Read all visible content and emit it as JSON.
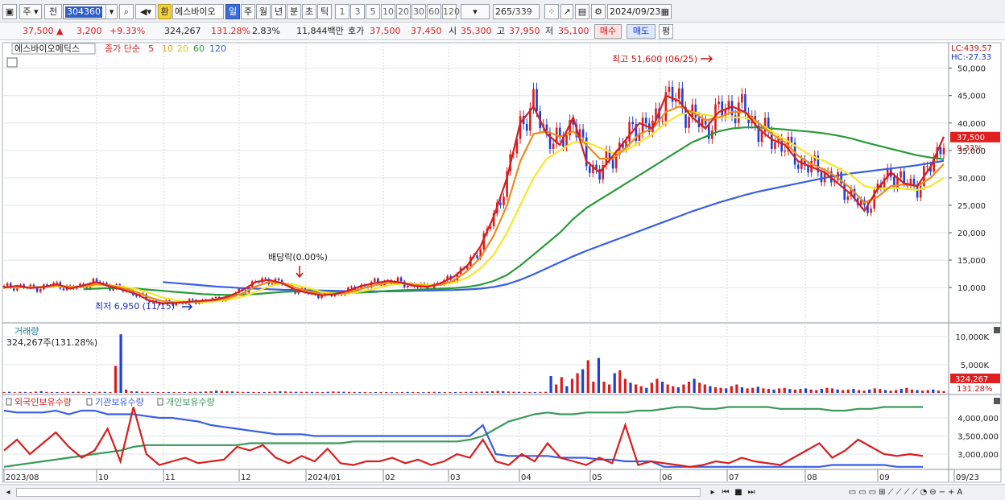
{
  "toolbar": {
    "mode": "주",
    "prev": "전",
    "code": "304360",
    "currency": "환",
    "stock_name": "에스바이오",
    "periods": [
      "일",
      "주",
      "월",
      "년",
      "분",
      "초",
      "틱"
    ],
    "intervals": [
      "1",
      "3",
      "5",
      "10",
      "20",
      "30",
      "60",
      "120"
    ],
    "count": "265",
    "total": "/339",
    "date": "2024/09/23"
  },
  "quote": {
    "price": "37,500",
    "change": "3,200",
    "change_pct": "+9.33%",
    "volume": "324,267",
    "vol_ratio": "131.28%",
    "turnover": "2.83%",
    "amount": "11,844백만",
    "bid_label": "호가",
    "bid": "37,500",
    "ask": "37,450",
    "open_label": "시",
    "open": "35,300",
    "high_label": "고",
    "high": "37,950",
    "low_label": "저",
    "low": "35,100",
    "buy_label": "매수",
    "sell_label": "매도",
    "eval_label": "평"
  },
  "colors": {
    "up": "#d81e1e",
    "down": "#1e3fd8",
    "ma5": "#d81e1e",
    "ma10": "#f08a1c",
    "ma20": "#f5e82a",
    "ma60": "#2a9a3a",
    "ma120": "#3a5fe0",
    "foreign": "#d81e1e",
    "institution": "#3a5fe0",
    "individual": "#3a9a5a"
  },
  "chart_data": [
    {
      "type": "line",
      "title": "에스바이오메딕스",
      "legend": {
        "prefix": "종가 단순",
        "items": [
          {
            "label": "5",
            "color": "#d81e1e"
          },
          {
            "label": "10",
            "color": "#f08a1c"
          },
          {
            "label": "20",
            "color": "#e8c51a"
          },
          {
            "label": "60",
            "color": "#2a9a3a"
          },
          {
            "label": "120",
            "color": "#3a5fe0"
          }
        ]
      },
      "x_labels": [
        "2023/08",
        "10",
        "11",
        "12",
        "2024/01",
        "02",
        "03",
        "04",
        "05",
        "06",
        "07",
        "08",
        "09",
        "09/23"
      ],
      "ylim": [
        4000,
        52000
      ],
      "yticks": [
        10000,
        15000,
        20000,
        25000,
        30000,
        35000,
        40000,
        45000,
        50000
      ],
      "ytick_labels": [
        "10,000",
        "15,000",
        "20,000",
        "25,000",
        "30,000",
        "35,000",
        "40,000",
        "45,000",
        "50,000"
      ],
      "annotations": {
        "high": "최고 51,600 (06/25)",
        "low": "최저 6,950 (11/15)",
        "dividend": "배당락(0.00%)",
        "lc": "LC:439.57",
        "hc": "HC:-27.33",
        "last_price": "37,500",
        "last_pct": "9.33%"
      },
      "series": [
        {
          "name": "5",
          "values": [
            10000,
            10300,
            9900,
            10100,
            10600,
            9800,
            10400,
            11000,
            10200,
            9600,
            8800,
            7600,
            7100,
            7200,
            7400,
            7600,
            7800,
            8400,
            9500,
            11000,
            11400,
            10800,
            9600,
            9000,
            8600,
            8800,
            9400,
            10300,
            10800,
            11200,
            10900,
            10300,
            10100,
            10800,
            12000,
            14000,
            17500,
            23000,
            30000,
            40000,
            43000,
            38000,
            36000,
            41000,
            33000,
            31000,
            34000,
            37000,
            40000,
            39000,
            45000,
            44000,
            41000,
            39000,
            42000,
            43000,
            42000,
            39000,
            37000,
            36000,
            33000,
            32000,
            31000,
            29000,
            27000,
            24000,
            28000,
            31000,
            29000,
            28500,
            32000,
            37500
          ]
        },
        {
          "name": "10",
          "values": [
            10000,
            10100,
            10000,
            10100,
            10400,
            10100,
            10200,
            10600,
            10400,
            9900,
            9200,
            8200,
            7500,
            7300,
            7350,
            7500,
            7700,
            8100,
            8900,
            10200,
            11000,
            10900,
            10000,
            9300,
            8800,
            8800,
            9100,
            9800,
            10400,
            10900,
            10900,
            10500,
            10300,
            10500,
            11300,
            13000,
            15500,
            19500,
            25000,
            33000,
            38000,
            38500,
            37500,
            38500,
            36000,
            33500,
            33500,
            35500,
            38000,
            39000,
            42000,
            43000,
            42000,
            40500,
            41000,
            42000,
            42000,
            40000,
            38000,
            36500,
            34000,
            32500,
            31500,
            30000,
            28000,
            25500,
            26500,
            28500,
            28800,
            28500,
            30000,
            32500
          ]
        },
        {
          "name": "20",
          "values": [
            10000,
            10000,
            10050,
            10100,
            10200,
            10150,
            10150,
            10400,
            10400,
            10200,
            9700,
            9000,
            8200,
            7700,
            7400,
            7350,
            7500,
            7800,
            8300,
            9200,
            10200,
            10800,
            10500,
            9900,
            9200,
            8900,
            8900,
            9300,
            9800,
            10400,
            10700,
            10700,
            10500,
            10500,
            10900,
            11800,
            13500,
            16000,
            20000,
            25000,
            30000,
            33500,
            35000,
            36500,
            36500,
            35500,
            34500,
            35000,
            36500,
            38000,
            40000,
            41500,
            42000,
            41500,
            41000,
            41000,
            41000,
            40000,
            38500,
            37000,
            35500,
            34000,
            33000,
            31800,
            30500,
            28500,
            28000,
            28200,
            28000,
            27800,
            28500,
            30000
          ]
        },
        {
          "name": "60",
          "values": [
            null,
            null,
            null,
            null,
            null,
            null,
            9700,
            9800,
            9900,
            9900,
            9800,
            9600,
            9400,
            9200,
            9000,
            8800,
            8700,
            8650,
            8700,
            8800,
            9000,
            9200,
            9300,
            9300,
            9200,
            9100,
            9050,
            9100,
            9200,
            9400,
            9500,
            9600,
            9700,
            9800,
            9900,
            10100,
            10500,
            11200,
            12300,
            14000,
            16000,
            18000,
            20000,
            22500,
            24500,
            26000,
            27500,
            29000,
            30500,
            32000,
            33500,
            35000,
            36500,
            37500,
            38500,
            39000,
            39200,
            39200,
            39000,
            38800,
            38600,
            38400,
            38100,
            37700,
            37200,
            36500,
            35900,
            35300,
            34700,
            34100,
            33700,
            33400
          ]
        },
        {
          "name": "120",
          "values": [
            null,
            null,
            null,
            null,
            null,
            null,
            null,
            null,
            null,
            null,
            null,
            null,
            11000,
            10800,
            10600,
            10400,
            10200,
            10050,
            9900,
            9800,
            9700,
            9600,
            9550,
            9500,
            9450,
            9400,
            9350,
            9300,
            9300,
            9300,
            9350,
            9400,
            9450,
            9500,
            9550,
            9650,
            9800,
            10100,
            10600,
            11400,
            12400,
            13500,
            14600,
            15700,
            16700,
            17600,
            18500,
            19400,
            20300,
            21200,
            22100,
            23000,
            23900,
            24700,
            25500,
            26200,
            26900,
            27500,
            28000,
            28500,
            29000,
            29500,
            30000,
            30400,
            30800,
            31100,
            31400,
            31700,
            32000,
            32300,
            32700,
            33100
          ]
        }
      ]
    },
    {
      "type": "bar",
      "title": "거래량",
      "subtitle": "324,267주(131.28%)",
      "ylim": [
        0,
        12000
      ],
      "yticks": [
        5000,
        10000
      ],
      "ytick_labels": [
        "5,000K",
        "10,000K"
      ],
      "last_value": "324,267",
      "last_pct": "131.28%",
      "values": [
        150,
        200,
        120,
        180,
        160,
        140,
        220,
        300,
        180,
        160,
        150,
        140,
        170,
        180,
        200,
        160,
        150,
        170,
        190,
        180,
        150,
        4800,
        10400,
        600,
        300,
        250,
        200,
        180,
        160,
        150,
        140,
        160,
        150,
        140,
        150,
        160,
        180,
        200,
        250,
        300,
        400,
        350,
        300,
        250,
        200,
        180,
        170,
        160,
        150,
        140,
        180,
        250,
        300,
        260,
        220,
        200,
        190,
        180,
        170,
        160,
        150,
        200,
        250,
        220,
        200,
        180,
        160,
        150,
        140,
        130,
        150,
        160,
        140,
        130,
        120,
        150,
        160,
        150,
        140,
        130,
        170,
        180,
        160,
        150,
        140,
        150,
        160,
        170,
        180,
        200,
        220,
        250,
        300,
        350,
        300,
        250,
        200,
        180,
        170,
        160,
        150,
        180,
        200,
        3000,
        1500,
        2800,
        1200,
        2500,
        3500,
        4200,
        5800,
        2000,
        6200,
        2000,
        1500,
        3500,
        4000,
        2500,
        1800,
        1500,
        1200,
        900,
        1800,
        2500,
        2000,
        1500,
        1200,
        1000,
        1500,
        2000,
        2500,
        1800,
        1500,
        1200,
        1000,
        900,
        800,
        1200,
        1500,
        1000,
        800,
        900,
        1100,
        800,
        700,
        600,
        800,
        900,
        700,
        600,
        700,
        800,
        600,
        500,
        700,
        900,
        800,
        600,
        500,
        600,
        700,
        500,
        400,
        600,
        800,
        700,
        500,
        400,
        500,
        700,
        900,
        600,
        500,
        400,
        500,
        600,
        400,
        324
      ]
    },
    {
      "type": "line",
      "title": "외국인보유수량",
      "series": [
        {
          "name": "외국인보유수량",
          "values": [
            3100000,
            3400000,
            3000000,
            3300000,
            3600000,
            3200000,
            2900000,
            3100000,
            3700000,
            2800000,
            4300000,
            3000000,
            2700000,
            2800000,
            2900000,
            2750000,
            2800000,
            2850000,
            3200000,
            3100000,
            3250000,
            2900000,
            2750000,
            2950000,
            2800000,
            3150000,
            2750000,
            2700000,
            2800000,
            2800000,
            2900000,
            2750000,
            2850000,
            2700000,
            2800000,
            3000000,
            2900000,
            3400000,
            2800000,
            2700000,
            3000000,
            2800000,
            3300000,
            2900000,
            2800000,
            2700000,
            2900000,
            2750000,
            3800000,
            2700000,
            2800000,
            2750000,
            2700000,
            2650000,
            2700000,
            2800000,
            2750000,
            2900000,
            2800000,
            2750000,
            2700000,
            2900000,
            3100000,
            3300000,
            2900000,
            3100000,
            3400000,
            3200000,
            3000000,
            2950000,
            3000000,
            2950000
          ]
        },
        {
          "name": "기관보유수량",
          "values": [
            4200000,
            4150000,
            4150000,
            4150000,
            4200000,
            4100000,
            4200000,
            4200000,
            4100000,
            4100000,
            4100000,
            4050000,
            4000000,
            4000000,
            3950000,
            3900000,
            3800000,
            3750000,
            3700000,
            3650000,
            3600000,
            3550000,
            3550000,
            3550000,
            3500000,
            3500000,
            3500000,
            3500000,
            3500000,
            3500000,
            3500000,
            3500000,
            3500000,
            3500000,
            3500000,
            3500000,
            3500000,
            3800000,
            3000000,
            2950000,
            2950000,
            2950000,
            2950000,
            2900000,
            2900000,
            2900000,
            2850000,
            2850000,
            2800000,
            2800000,
            2800000,
            2650000,
            2650000,
            2650000,
            2650000,
            2650000,
            2650000,
            2650000,
            2650000,
            2650000,
            2650000,
            2650000,
            2650000,
            2650000,
            2700000,
            2700000,
            2700000,
            2700000,
            2700000,
            2650000,
            2650000,
            2650000
          ]
        },
        {
          "name": "개인보유수량",
          "values": [
            2650000,
            2700000,
            2750000,
            2800000,
            2850000,
            2900000,
            2950000,
            3000000,
            3050000,
            3100000,
            3200000,
            3250000,
            3250000,
            3250000,
            3250000,
            3250000,
            3250000,
            3250000,
            3250000,
            3300000,
            3300000,
            3300000,
            3300000,
            3300000,
            3300000,
            3300000,
            3300000,
            3350000,
            3350000,
            3350000,
            3350000,
            3350000,
            3350000,
            3350000,
            3350000,
            3350000,
            3400000,
            3500000,
            3700000,
            3900000,
            4000000,
            4100000,
            4150000,
            4100000,
            4100000,
            4150000,
            4150000,
            4150000,
            4150000,
            4200000,
            4200000,
            4250000,
            4300000,
            4300000,
            4250000,
            4250000,
            4300000,
            4300000,
            4300000,
            4300000,
            4250000,
            4250000,
            4250000,
            4250000,
            4200000,
            4200000,
            4250000,
            4250000,
            4300000,
            4300000,
            4300000,
            4300000
          ]
        }
      ],
      "legend": [
        "외국인보유수량",
        "기관보유수량",
        "개인보유수량"
      ],
      "ylim": [
        2600000,
        4600000
      ],
      "yticks": [
        3000000,
        3500000,
        4000000
      ],
      "ytick_labels": [
        "3,000,000",
        "3,500,000",
        "4,000,000"
      ]
    }
  ],
  "bottom": {
    "icons": [
      "first-icon",
      "prev-icon",
      "stop-icon",
      "next-icon"
    ]
  }
}
